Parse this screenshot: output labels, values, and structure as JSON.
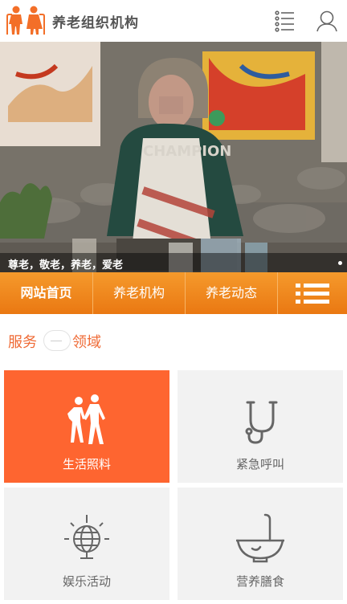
{
  "header": {
    "site_name": "养老组织机构",
    "logo_icon": "elderly-couple-icon",
    "menu_icon": "list-menu-icon",
    "user_icon": "user-icon",
    "brand_color": "#f36f28"
  },
  "banner": {
    "caption": "尊老，敬老，养老，爱老"
  },
  "nav": {
    "items": [
      {
        "label": "网站首页"
      },
      {
        "label": "养老机构"
      },
      {
        "label": "养老动态"
      }
    ],
    "menu_icon": "hamburger-icon",
    "color": "#f08a1f"
  },
  "section": {
    "title_left": "服务",
    "title_right": "领域",
    "accent": "#ef6a35"
  },
  "services": [
    {
      "label": "生活照料",
      "icon": "walking-people-icon"
    },
    {
      "label": "紧急呼叫",
      "icon": "stethoscope-icon"
    },
    {
      "label": "娱乐活动",
      "icon": "globe-icon"
    },
    {
      "label": "营养膳食",
      "icon": "bowl-spoon-icon"
    }
  ]
}
